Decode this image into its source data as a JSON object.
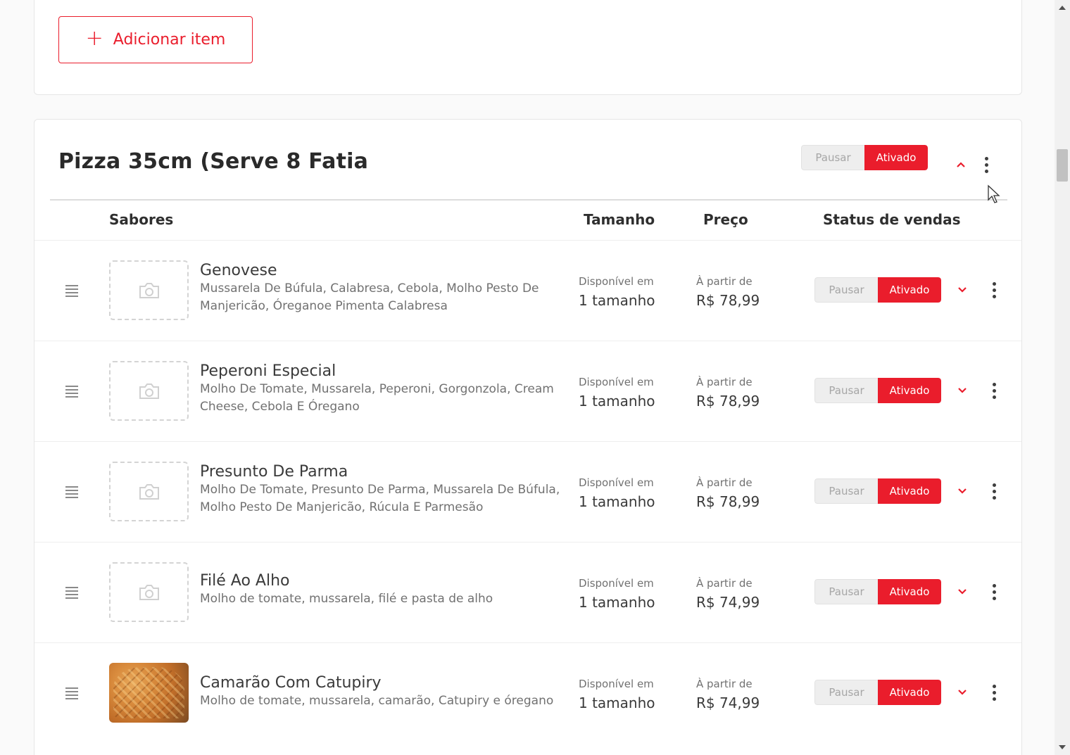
{
  "add_item": {
    "label": "Adicionar item",
    "icon": "plus-icon"
  },
  "category": {
    "title": "Pizza 35cm (Serve 8 Fatia",
    "pause_label": "Pausar",
    "active_label": "Ativado"
  },
  "columns": {
    "flavors": "Sabores",
    "size": "Tamanho",
    "price": "Preço",
    "sales_status": "Status de vendas"
  },
  "items": [
    {
      "name": "Genovese",
      "description": "Mussarela De Búfula, Calabresa, Cebola, Molho Pesto De Manjericão, Óreganoe Pimenta Calabresa",
      "avail_label": "Disponível em",
      "avail_value": "1 tamanho",
      "price_label": "À partir de",
      "price_value": "R$ 78,99",
      "pause_label": "Pausar",
      "active_label": "Ativado",
      "has_photo": false
    },
    {
      "name": "Peperoni Especial",
      "description": "Molho De Tomate, Mussarela, Peperoni, Gorgonzola, Cream Cheese, Cebola E Óregano",
      "avail_label": "Disponível em",
      "avail_value": "1 tamanho",
      "price_label": "À partir de",
      "price_value": "R$ 78,99",
      "pause_label": "Pausar",
      "active_label": "Ativado",
      "has_photo": false
    },
    {
      "name": "Presunto De Parma",
      "description": "Molho De Tomate, Presunto De Parma, Mussarela De Búfula, Molho Pesto De Manjericão, Rúcula E Parmesão",
      "avail_label": "Disponível em",
      "avail_value": "1 tamanho",
      "price_label": "À partir de",
      "price_value": "R$ 78,99",
      "pause_label": "Pausar",
      "active_label": "Ativado",
      "has_photo": false
    },
    {
      "name": "Filé Ao Alho",
      "description": "Molho de tomate, mussarela, filé e pasta de alho",
      "avail_label": "Disponível em",
      "avail_value": "1 tamanho",
      "price_label": "À partir de",
      "price_value": "R$ 74,99",
      "pause_label": "Pausar",
      "active_label": "Ativado",
      "has_photo": false
    },
    {
      "name": "Camarão Com Catupiry",
      "description": "Molho de tomate, mussarela, camarão, Catupiry e óregano",
      "avail_label": "Disponível em",
      "avail_value": "1 tamanho",
      "price_label": "À partir de",
      "price_value": "R$ 74,99",
      "pause_label": "Pausar",
      "active_label": "Ativado",
      "has_photo": true
    }
  ],
  "colors": {
    "accent": "#ea1d2c",
    "text": "#3e3e3e",
    "muted": "#717171"
  }
}
